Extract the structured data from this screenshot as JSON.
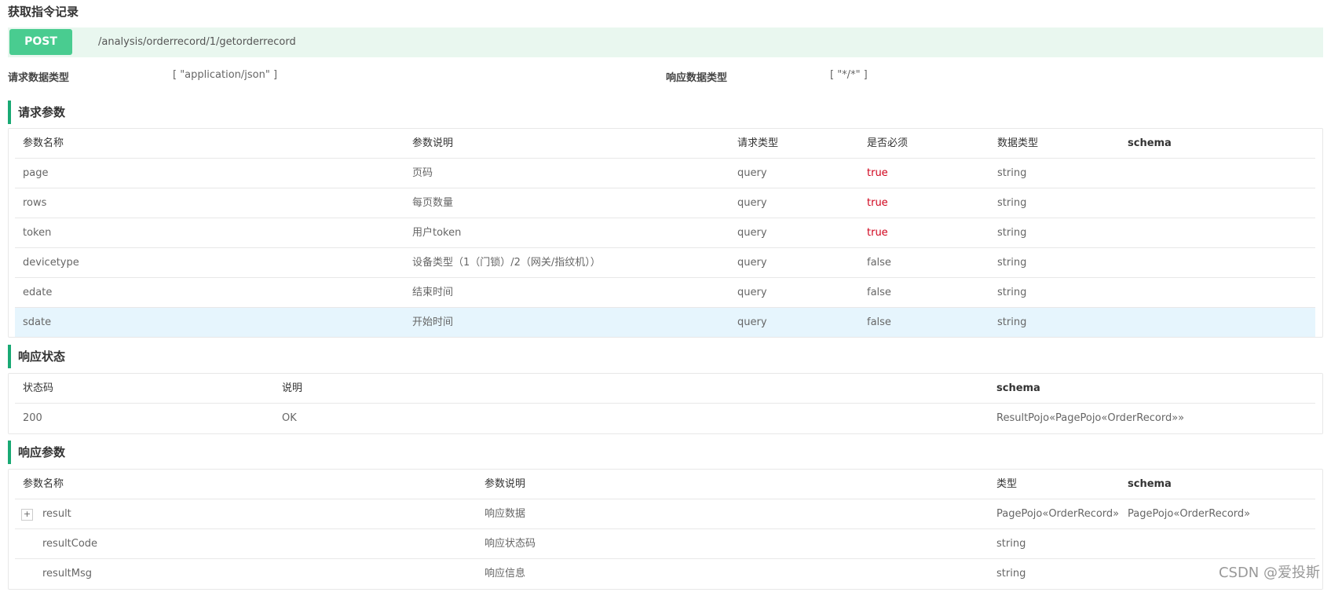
{
  "page": {
    "title": "获取指令记录",
    "method": "POST",
    "path": "/analysis/orderrecord/1/getorderrecord",
    "request_content_type_label": "请求数据类型",
    "request_content_type_value": "[ \"application/json\" ]",
    "response_content_type_label": "响应数据类型",
    "response_content_type_value": "[ \"*/*\" ]"
  },
  "request_params": {
    "section_title": "请求参数",
    "headers": [
      "参数名称",
      "参数说明",
      "请求类型",
      "是否必须",
      "数据类型",
      "schema"
    ],
    "rows": [
      {
        "name": "page",
        "desc": "页码",
        "in": "query",
        "required": "true",
        "type": "string",
        "schema": ""
      },
      {
        "name": "rows",
        "desc": "每页数量",
        "in": "query",
        "required": "true",
        "type": "string",
        "schema": ""
      },
      {
        "name": "token",
        "desc": "用户token",
        "in": "query",
        "required": "true",
        "type": "string",
        "schema": ""
      },
      {
        "name": "devicetype",
        "desc": "设备类型（1（门锁）/2（网关/指纹机））",
        "in": "query",
        "required": "false",
        "type": "string",
        "schema": ""
      },
      {
        "name": "edate",
        "desc": "结束时间",
        "in": "query",
        "required": "false",
        "type": "string",
        "schema": ""
      },
      {
        "name": "sdate",
        "desc": "开始时间",
        "in": "query",
        "required": "false",
        "type": "string",
        "schema": ""
      }
    ]
  },
  "response_status": {
    "section_title": "响应状态",
    "headers": [
      "状态码",
      "说明",
      "schema"
    ],
    "rows": [
      {
        "code": "200",
        "desc": "OK",
        "schema": "ResultPojo«PagePojo«OrderRecord»»"
      }
    ]
  },
  "response_params": {
    "section_title": "响应参数",
    "headers": [
      "参数名称",
      "参数说明",
      "类型",
      "schema"
    ],
    "rows": [
      {
        "expand": "+",
        "name": "result",
        "desc": "响应数据",
        "type": "PagePojo«OrderRecord»",
        "schema": "PagePojo«OrderRecord»"
      },
      {
        "name": "resultCode",
        "desc": "响应状态码",
        "type": "string",
        "schema": ""
      },
      {
        "name": "resultMsg",
        "desc": "响应信息",
        "type": "string",
        "schema": ""
      }
    ]
  },
  "watermark": "CSDN @爱投斯",
  "colors": {
    "post_badge": "#49cc90",
    "endpoint_bg": "#e9f7ef",
    "section_bar": "#19a974",
    "required_true": "#d0021b",
    "row_highlight": "#e6f5fd"
  }
}
